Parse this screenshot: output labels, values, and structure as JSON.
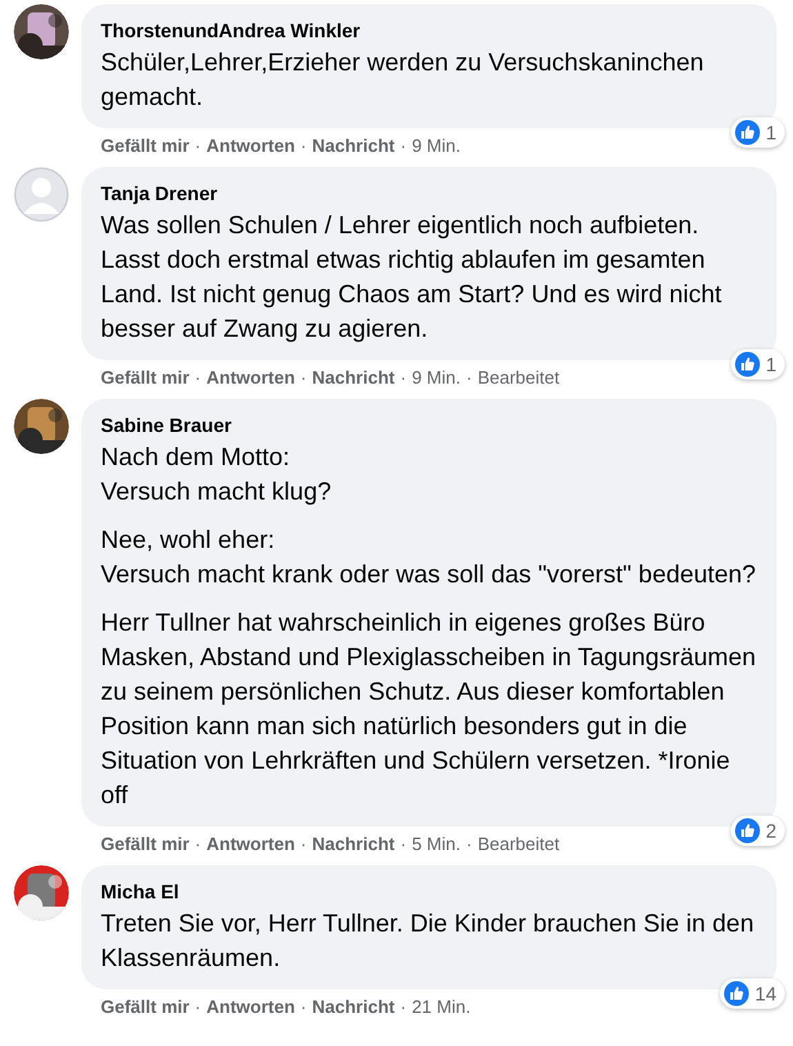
{
  "separator": "·",
  "comments": [
    {
      "author": "ThorstenundAndrea Winkler",
      "avatar": {
        "kind": "picture"
      },
      "paragraphs": [
        "Schüler,Lehrer,Erzieher werden zu Versuchskaninchen gemacht."
      ],
      "reactions": "1",
      "actions": [
        "Gefällt mir",
        "Antworten",
        "Nachricht"
      ],
      "time": "9 Min."
    },
    {
      "author": "Tanja Drener",
      "avatar": {
        "kind": "default"
      },
      "paragraphs": [
        "Was sollen Schulen / Lehrer eigentlich noch aufbieten. Lasst doch erstmal etwas richtig ablaufen im gesamten Land. Ist nicht genug Chaos am Start? Und es wird nicht besser auf Zwang zu agieren."
      ],
      "reactions": "1",
      "actions": [
        "Gefällt mir",
        "Antworten",
        "Nachricht"
      ],
      "time": "9 Min.",
      "edited": "Bearbeitet"
    },
    {
      "author": "Sabine Brauer",
      "avatar": {
        "kind": "picture"
      },
      "paragraphs": [
        "Nach dem Motto:\nVersuch macht klug?",
        "Nee, wohl eher:\nVersuch macht krank oder was soll das \"vorerst\" bedeuten?",
        "Herr Tullner hat wahrscheinlich in eigenes großes Büro Masken, Abstand und Plexiglasscheiben in Tagungsräumen zu seinem persönlichen Schutz. Aus dieser komfortablen Position kann man sich natürlich besonders gut in die Situation von Lehrkräften und Schülern versetzen. *Ironie off"
      ],
      "reactions": "2",
      "actions": [
        "Gefällt mir",
        "Antworten",
        "Nachricht"
      ],
      "time": "5 Min.",
      "edited": "Bearbeitet"
    },
    {
      "author": "Micha El",
      "avatar": {
        "kind": "picture"
      },
      "paragraphs": [
        "Treten Sie vor, Herr Tullner. Die Kinder brauchen Sie in den Klassenräumen."
      ],
      "reactions": "14",
      "actions": [
        "Gefällt mir",
        "Antworten",
        "Nachricht"
      ],
      "time": "21 Min."
    }
  ]
}
